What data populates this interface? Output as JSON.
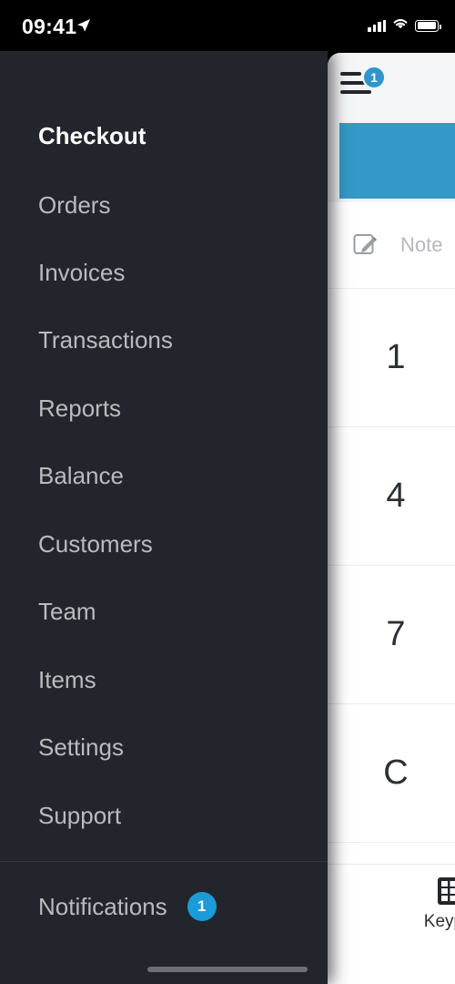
{
  "status_bar": {
    "time": "09:41",
    "location_icon": "location-arrow-icon",
    "signal_icon": "cellular-signal-icon",
    "wifi_icon": "wifi-icon",
    "battery_icon": "battery-full-icon"
  },
  "drawer": {
    "items": [
      {
        "label": "Checkout",
        "active": true
      },
      {
        "label": "Orders",
        "active": false
      },
      {
        "label": "Invoices",
        "active": false
      },
      {
        "label": "Transactions",
        "active": false
      },
      {
        "label": "Reports",
        "active": false
      },
      {
        "label": "Balance",
        "active": false
      },
      {
        "label": "Customers",
        "active": false
      },
      {
        "label": "Team",
        "active": false
      },
      {
        "label": "Items",
        "active": false
      },
      {
        "label": "Settings",
        "active": false
      },
      {
        "label": "Support",
        "active": false
      }
    ],
    "notifications": {
      "label": "Notifications",
      "badge": "1"
    }
  },
  "content": {
    "menu_icon": "hamburger-menu-icon",
    "menu_badge": "1",
    "note": {
      "icon": "edit-note-pencil-icon",
      "label": "Note"
    },
    "keypad_rows": [
      {
        "digit": "1"
      },
      {
        "digit": "4"
      },
      {
        "digit": "7"
      },
      {
        "digit": "C"
      }
    ],
    "tab": {
      "icon": "keypad-grid-icon",
      "label": "Keypad"
    }
  },
  "colors": {
    "accent_blue": "#3498c8",
    "badge_blue": "#1b9bd8",
    "drawer_bg": "#22262c",
    "panel_header_bg": "#f4f5f7"
  }
}
